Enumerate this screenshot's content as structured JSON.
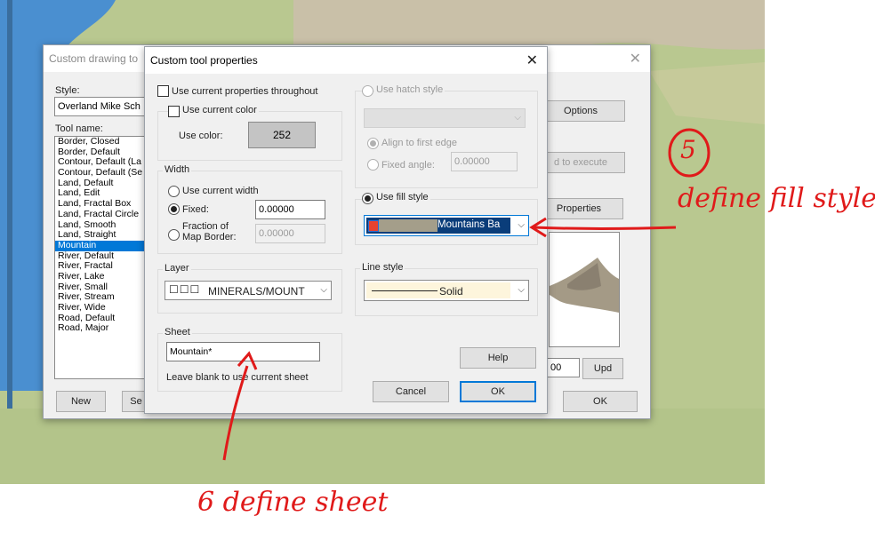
{
  "bg_window": {
    "title": "Custom drawing to",
    "style_label": "Style:",
    "style_value": "Overland Mike Sch",
    "tool_name_label": "Tool name:",
    "tools": [
      "Border, Closed",
      "Border, Default",
      "Contour, Default (La",
      "Contour, Default (Se",
      "Land, Default",
      "Land, Edit",
      "Land, Fractal Box",
      "Land, Fractal Circle",
      "Land, Smooth",
      "Land, Straight",
      "Mountain",
      "River, Default",
      "River, Fractal",
      "River, Lake",
      "River, Small",
      "River, Stream",
      "River, Wide",
      "Road, Default",
      "Road, Major"
    ],
    "selected_tool": "Mountain",
    "options_label": "Options",
    "execute_label": "d to execute",
    "properties_label": "Properties",
    "new_label": "New",
    "se_label": "Se",
    "ok_label": "OK",
    "upd_label": "Upd",
    "num_value": "00"
  },
  "dialog": {
    "title": "Custom tool properties",
    "use_current_props": "Use current properties throughout",
    "use_current_color": "Use current color",
    "use_color_label": "Use color:",
    "color_value": "252",
    "width": {
      "label": "Width",
      "use_current": "Use current width",
      "fixed": "Fixed:",
      "fixed_value": "0.00000",
      "fraction": "Fraction of",
      "map_border": "Map Border:",
      "fraction_value": "0.00000"
    },
    "hatch": {
      "label": "Use hatch style",
      "align": "Align to first edge",
      "fixed_angle": "Fixed angle:",
      "angle_value": "0.00000"
    },
    "fill": {
      "label": "Use fill style",
      "value": "Mountains Ba"
    },
    "layer": {
      "label": "Layer",
      "value": "MINERALS/MOUNT"
    },
    "line_style": {
      "label": "Line style",
      "value": "Solid"
    },
    "sheet": {
      "label": "Sheet",
      "value": "Mountain*",
      "hint": "Leave blank to use current sheet"
    },
    "help_label": "Help",
    "cancel_label": "Cancel",
    "ok_label": "OK"
  },
  "annotations": {
    "step5_number": "5",
    "step5_text": "define fill style",
    "step6_text": "6  define sheet"
  },
  "colors": {
    "selection": "#0078d7",
    "annotation": "#e01a1a",
    "water": "#4a8fd0",
    "terrain": "#b5c58c"
  }
}
